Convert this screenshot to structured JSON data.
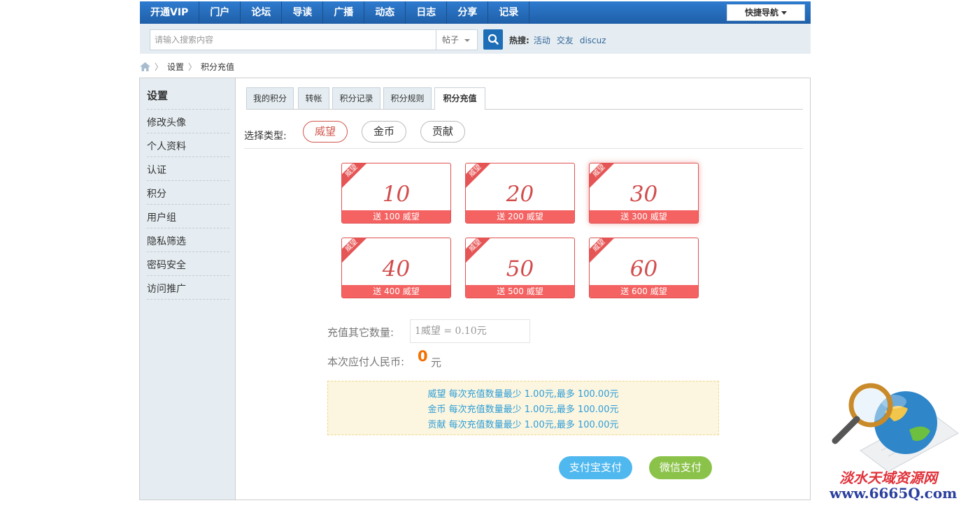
{
  "topnav": {
    "items": [
      "开通VIP",
      "门户",
      "论坛",
      "导读",
      "广播",
      "动态",
      "日志",
      "分享",
      "记录"
    ],
    "quick_nav": "快捷导航"
  },
  "search": {
    "placeholder": "请输入搜索内容",
    "type": "帖子",
    "hot_label": "热搜:",
    "hot_terms": [
      "活动",
      "交友",
      "discuz"
    ]
  },
  "breadcrumb": [
    "设置",
    "积分充值"
  ],
  "sidebar": {
    "title": "设置",
    "items": [
      "修改头像",
      "个人资料",
      "认证",
      "积分",
      "用户组",
      "隐私筛选",
      "密码安全",
      "访问推广"
    ]
  },
  "tabs": [
    "我的积分",
    "转帐",
    "积分记录",
    "积分规则",
    "积分充值"
  ],
  "type_select": {
    "label": "选择类型:",
    "options": [
      "威望",
      "金币",
      "贡献"
    ]
  },
  "cards": [
    {
      "ribbon": "威望",
      "amount": "10",
      "gift": "送 100 威望"
    },
    {
      "ribbon": "威望",
      "amount": "20",
      "gift": "送 200 威望"
    },
    {
      "ribbon": "威望",
      "amount": "30",
      "gift": "送 300 威望"
    },
    {
      "ribbon": "威望",
      "amount": "40",
      "gift": "送 400 威望"
    },
    {
      "ribbon": "威望",
      "amount": "50",
      "gift": "送 500 威望"
    },
    {
      "ribbon": "威望",
      "amount": "60",
      "gift": "送 600 威望"
    }
  ],
  "custom_amount": {
    "label": "充值其它数量:",
    "placeholder": "1威望 = 0.10元"
  },
  "payment": {
    "label": "本次应付人民币:",
    "amount": "0",
    "unit": "元"
  },
  "notice": [
    "威望 每次充值数量最少 1.00元,最多 100.00元",
    "金币 每次充值数量最少 1.00元,最多 100.00元",
    "贡献 每次充值数量最少 1.00元,最多 100.00元"
  ],
  "buttons": {
    "alipay": "支付宝支付",
    "wechat": "微信支付"
  },
  "watermark": {
    "line1": "淡水天域资源网",
    "line2": "www.6665Q.com"
  },
  "colors": {
    "nav_blue": "#1f5fa8",
    "accent_red": "#e05150",
    "alipay_blue": "#4fb8ef",
    "wechat_green": "#8bc34a"
  }
}
